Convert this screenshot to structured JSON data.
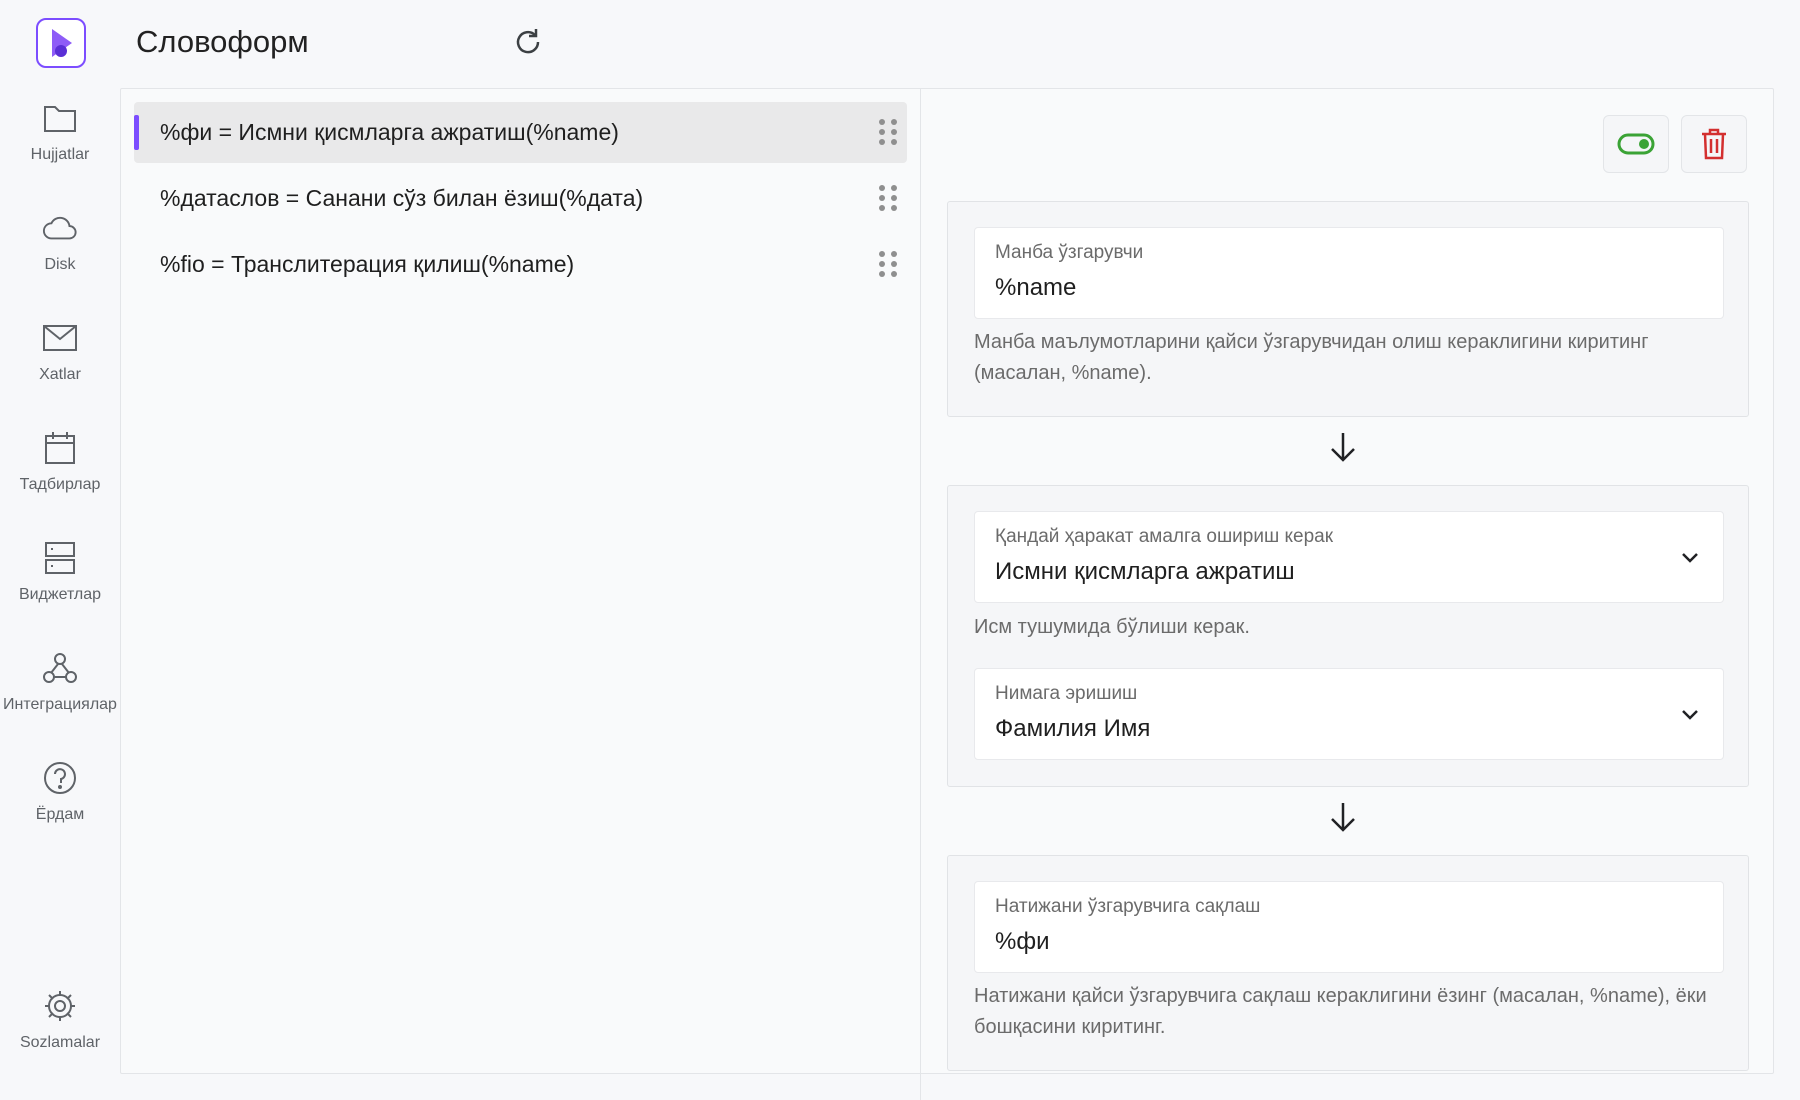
{
  "app": {
    "title": "Словоформ"
  },
  "sidebar": {
    "items": [
      {
        "label": "Hujjatlar",
        "icon": "folder-icon"
      },
      {
        "label": "Disk",
        "icon": "cloud-icon"
      },
      {
        "label": "Xatlar",
        "icon": "mail-icon"
      },
      {
        "label": "Тадбирлар",
        "icon": "calendar-icon"
      },
      {
        "label": "Виджетлар",
        "icon": "widgets-icon"
      },
      {
        "label": "Интеграциялар",
        "icon": "webhook-icon"
      },
      {
        "label": "Ёрдам",
        "icon": "help-icon"
      },
      {
        "label": "Sozlamalar",
        "icon": "gear-icon"
      }
    ]
  },
  "rules": [
    {
      "text": "%фи = Исмни қисмларга ажратиш(%name)",
      "active": true
    },
    {
      "text": "%датаслов = Санани сўз билан ёзиш(%дата)",
      "active": false
    },
    {
      "text": "%fio = Транслитерация қилиш(%name)",
      "active": false
    }
  ],
  "editor": {
    "toggle_state": "on",
    "source": {
      "label": "Манба ўзгарувчи",
      "value": "%name",
      "helper": "Манба маълумотларини қайси ўзгарувчидан олиш кераклигини киритинг (масалан, %name)."
    },
    "action": {
      "label": "Қандай ҳаракат амалга ошириш керак",
      "value": "Исмни қисмларга ажратиш",
      "helper": "Исм тушумида бўлиши керак."
    },
    "target": {
      "label": "Нимага эришиш",
      "value": "Фамилия Имя"
    },
    "result": {
      "label": "Натижани ўзгарувчига сақлаш",
      "value": "%фи",
      "helper": "Натижани қайси ўзгарувчига сақлаш кераклигини ёзинг (масалан, %name), ёки бошқасини киритинг."
    }
  },
  "colors": {
    "accent": "#7c4dff",
    "toggle": "#3aa335",
    "delete": "#d32f2f"
  }
}
